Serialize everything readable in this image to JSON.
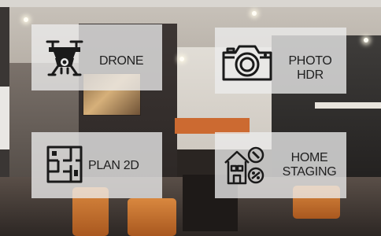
{
  "tiles": [
    {
      "id": "drone",
      "label": "DRONE",
      "icon": "drone-icon"
    },
    {
      "id": "photo",
      "label_line1": "PHOTO",
      "label_line2": "HDR",
      "icon": "camera-icon"
    },
    {
      "id": "plan",
      "label": "PLAN 2D",
      "icon": "floor-plan-icon"
    },
    {
      "id": "staging",
      "label_line1": "HOME",
      "label_line2": "STAGING",
      "icon": "home-staging-icon"
    }
  ],
  "colors": {
    "tile_bg": "#ececec",
    "text": "#1f1f1f",
    "icon": "#1a1a1a"
  }
}
